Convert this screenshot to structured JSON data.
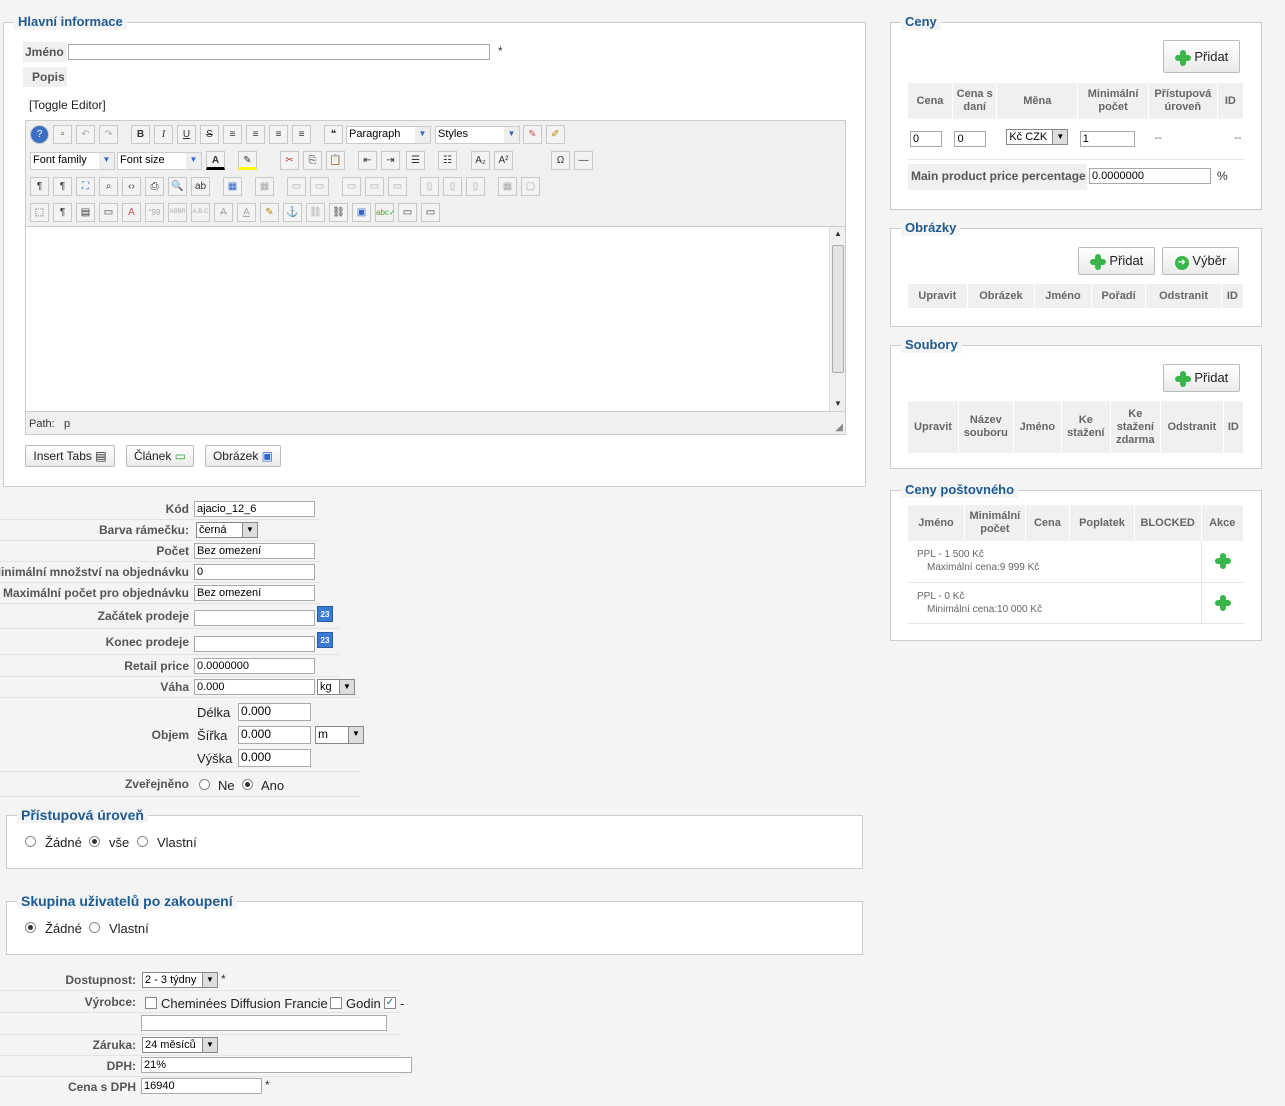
{
  "main": {
    "legend": "Hlavní informace",
    "name_label": "Jméno",
    "name_value": "",
    "required": "*",
    "desc_label": "Popis",
    "toggle_editor": "[Toggle Editor]",
    "format_select": "Paragraph",
    "styles_select": "Styles",
    "font_family": "Font family",
    "font_size": "Font size",
    "path_label": "Path:",
    "path_value": "p",
    "btn_insert_tabs": "Insert Tabs",
    "btn_clanek": "Článek",
    "btn_obrazek": "Obrázek"
  },
  "props": {
    "kod_label": "Kód",
    "kod_value": "ajacio_12_6",
    "barva_label": "Barva rámečku:",
    "barva_value": "černá",
    "pocet_label": "Počet",
    "pocet_value": "Bez omezení",
    "minmn_label": "Minimální množství na objednávku",
    "minmn_value": "0",
    "maxpocet_label": "Maximální počet pro objednávku",
    "maxpocet_value": "Bez omezení",
    "zacatek_label": "Začátek prodeje",
    "zacatek_value": "",
    "konec_label": "Konec prodeje",
    "konec_value": "",
    "calendar_text": "23",
    "retail_label": "Retail price",
    "retail_value": "0.0000000",
    "vaha_label": "Váha",
    "vaha_value": "0.000",
    "vaha_unit": "kg",
    "objem_label": "Objem",
    "delka_label": "Délka",
    "delka_value": "0.000",
    "sirka_label": "Šířka",
    "sirka_value": "0.000",
    "objem_unit": "m",
    "vyska_label": "Výška",
    "vyska_value": "0.000",
    "zverejneno_label": "Zveřejněno",
    "ne": "Ne",
    "ano": "Ano"
  },
  "access": {
    "legend": "Přístupová úroveň",
    "opt1": "Žádné",
    "opt2": "vše",
    "opt3": "Vlastní"
  },
  "group": {
    "legend": "Skupina uživatelů po zakoupení",
    "opt1": "Žádné",
    "opt2": "Vlastní"
  },
  "bottom": {
    "dostupnost_label": "Dostupnost:",
    "dostupnost_value": "2 - 3 týdny",
    "vyrobce_label": "Výrobce:",
    "vyrobce1": "Cheminées Diffusion Francie",
    "vyrobce2": "Godin",
    "vyrobce3": "-",
    "zaruka_label": "Záruka:",
    "zaruka_value": "24 měsíců",
    "dph_label": "DPH:",
    "dph_value": "21%",
    "cenadph_label": "Cena s DPH",
    "cenadph_value": "16940"
  },
  "ceny": {
    "legend": "Ceny",
    "add": "Přidat",
    "cols": [
      "Cena",
      "Cena s daní",
      "Měna",
      "Minimální počet",
      "Přístupová úroveň",
      "ID"
    ],
    "row": {
      "cena": "0",
      "cena_dani": "0",
      "mena": "Kč CZK",
      "min": "1",
      "pristup": "--",
      "id": "--"
    },
    "pct_label": "Main product price percentage",
    "pct_value": "0.0000000",
    "pct_unit": "%"
  },
  "obrazky": {
    "legend": "Obrázky",
    "add": "Přidat",
    "choose": "Výběr",
    "cols": [
      "Upravit",
      "Obrázek",
      "Jméno",
      "Pořadí",
      "Odstranit",
      "ID"
    ]
  },
  "soubory": {
    "legend": "Soubory",
    "add": "Přidat",
    "cols": [
      "Upravit",
      "Název souboru",
      "Jméno",
      "Ke stažení",
      "Ke stažení zdarma",
      "Odstranit",
      "ID"
    ]
  },
  "postovne": {
    "legend": "Ceny poštovného",
    "cols": [
      "Jméno",
      "Minimální počet",
      "Cena",
      "Poplatek",
      "BLOCKED",
      "Akce"
    ],
    "rows": [
      {
        "name": "PPL - 1 500 Kč",
        "sub": "Maximální cena:9 999 Kč"
      },
      {
        "name": "PPL - 0 Kč",
        "sub": "Minimální cena:10 000 Kč"
      }
    ]
  }
}
